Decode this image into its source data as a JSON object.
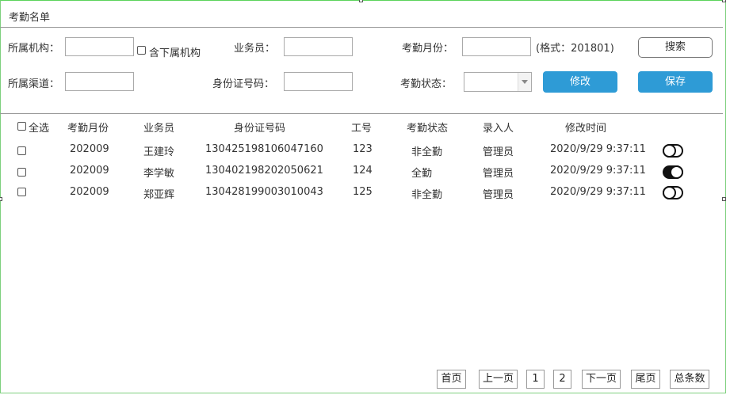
{
  "page": {
    "title": "考勤名单"
  },
  "filters": {
    "org_label": "所属机构：",
    "include_sub_label": "含下属机构",
    "salesperson_label": "业务员：",
    "month_label": "考勤月份：",
    "month_hint": "(格式：201801)",
    "search_button": "搜索",
    "channel_label": "所属渠道：",
    "id_label": "身份证号码：",
    "status_label": "考勤状态：",
    "edit_button": "修改",
    "save_button": "保存"
  },
  "table": {
    "select_all_label": "全选",
    "columns": [
      "考勤月份",
      "业务员",
      "身份证号码",
      "工号",
      "考勤状态",
      "录入人",
      "修改时间"
    ],
    "rows": [
      {
        "month": "202009",
        "name": "王建玲",
        "id_number": "130425198106047160",
        "emp_no": "123",
        "status": "非全勤",
        "entered_by": "管理员",
        "modified": "2020/9/29 9:37:11",
        "toggle_on": false
      },
      {
        "month": "202009",
        "name": "李学敏",
        "id_number": "130402198202050621",
        "emp_no": "124",
        "status": "全勤",
        "entered_by": "管理员",
        "modified": "2020/9/29 9:37:11",
        "toggle_on": true
      },
      {
        "month": "202009",
        "name": "郑亚辉",
        "id_number": "130428199003010043",
        "emp_no": "125",
        "status": "非全勤",
        "entered_by": "管理员",
        "modified": "2020/9/29 9:37:11",
        "toggle_on": false
      }
    ]
  },
  "pagination": {
    "first": "首页",
    "prev": "上一页",
    "page1": "1",
    "page2": "2",
    "next": "下一页",
    "last": "尾页",
    "total": "总条数"
  }
}
